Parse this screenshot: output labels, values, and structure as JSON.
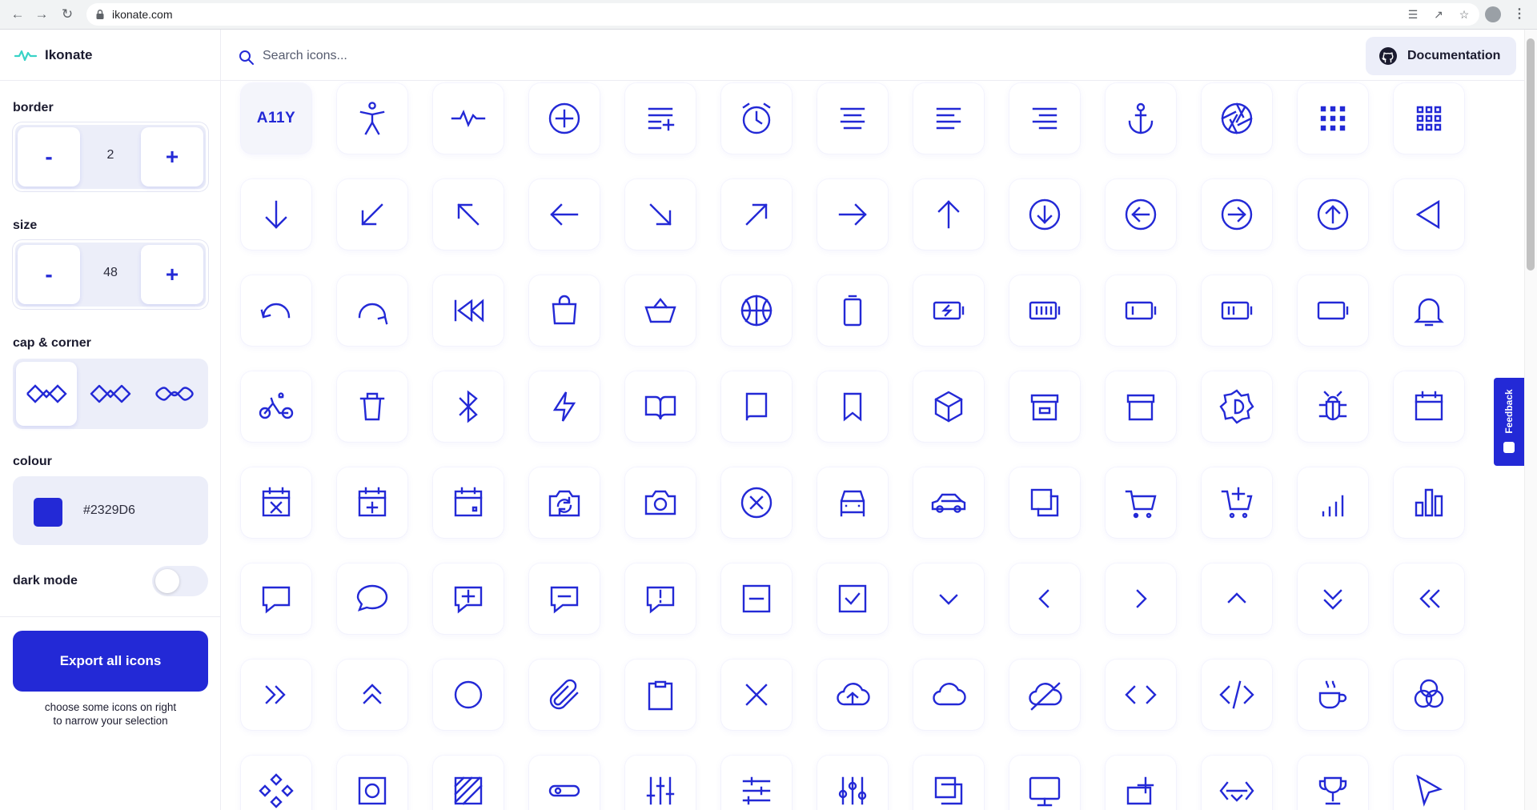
{
  "browser": {
    "url": "ikonate.com"
  },
  "app": {
    "name": "Ikonate",
    "accent": "#2329D6"
  },
  "controls": {
    "border": {
      "label": "border",
      "value": "2",
      "minus": "-",
      "plus": "+"
    },
    "size": {
      "label": "size",
      "value": "48",
      "minus": "-",
      "plus": "+"
    },
    "cap_corner": {
      "label": "cap & corner",
      "options": [
        "miter",
        "round",
        "rounded"
      ],
      "selected": "miter"
    },
    "colour": {
      "label": "colour",
      "value": "#2329D6"
    },
    "dark_mode": {
      "label": "dark mode",
      "on": false
    }
  },
  "export": {
    "label": "Export all icons",
    "hint": "choose some icons on right to narrow your selection"
  },
  "search": {
    "placeholder": "Search icons..."
  },
  "header": {
    "documentation_label": "Documentation"
  },
  "feedback": {
    "label": "Feedback"
  },
  "icons": [
    "a11y",
    "accessibility",
    "activity",
    "add",
    "add-to-list",
    "alarm",
    "align-center",
    "align-left",
    "align-right",
    "anchor",
    "aperture",
    "apps",
    "apps-alt",
    "arrow-down",
    "arrow-down-left",
    "arrow-up-left",
    "arrow-left",
    "arrow-down-right",
    "arrow-up-right",
    "arrow-right",
    "arrow-up",
    "arrow-down-circle",
    "arrow-left-circle",
    "arrow-right-circle",
    "arrow-up-circle",
    "arrow-left-triangle",
    "undo",
    "redo",
    "rewind",
    "bag",
    "basket",
    "basketball",
    "battery",
    "battery-charging",
    "battery-full",
    "battery-low",
    "battery-medium",
    "battery-empty",
    "bell",
    "bike",
    "bin",
    "bluetooth",
    "bolt",
    "book-opened",
    "book",
    "bookmark",
    "box",
    "box-alt",
    "box-alt2",
    "brightness",
    "bug",
    "calendar",
    "calendar-remove",
    "calendar-add",
    "calendar-event",
    "camera-refresh",
    "camera",
    "cancel",
    "car",
    "car-side",
    "copy",
    "cart",
    "cart-add",
    "signal",
    "statistics",
    "chat",
    "chat-bubble",
    "chat-add",
    "chat-remove",
    "chat-error",
    "remove-square",
    "checkbox",
    "chevron-down",
    "chevron-left",
    "chevron-right",
    "chevron-up",
    "chevrons-down",
    "chevrons-left",
    "chevrons-right",
    "chevrons-up",
    "circle",
    "paperclip",
    "clipboard",
    "close",
    "cloud-upload",
    "cloud",
    "cloud-off",
    "code",
    "code-alt",
    "coffee",
    "colour-mixer",
    "component",
    "contrast",
    "crop",
    "direction",
    "controls",
    "controls-alt",
    "controls-v",
    "copy-alt",
    "display",
    "add-square",
    "code-split",
    "cup",
    "cursor"
  ]
}
